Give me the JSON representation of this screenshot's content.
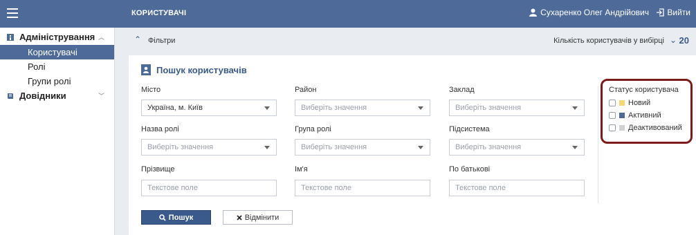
{
  "header": {
    "title": "КОРИСТУВАЧІ",
    "user_name": "Сухаренко Олег Андрійович",
    "logout_label": "Вийти"
  },
  "sidebar": {
    "sections": [
      {
        "label": "Адміністрування",
        "items": [
          {
            "label": "Користувачі",
            "active": true
          },
          {
            "label": "Ролі",
            "active": false
          },
          {
            "label": "Групи ролі",
            "active": false
          }
        ]
      },
      {
        "label": "Довідники",
        "items": []
      }
    ]
  },
  "filterbar": {
    "label": "Фільтри",
    "count_label": "Кількість користувачів у вибірці",
    "count_value": "20"
  },
  "search_panel": {
    "title": "Пошук користувачів",
    "fields": {
      "city": {
        "label": "Місто",
        "value": "Україна, м. Київ"
      },
      "district": {
        "label": "Район",
        "placeholder": "Виберіть значення"
      },
      "institution": {
        "label": "Заклад",
        "placeholder": "Виберіть значення"
      },
      "role_name": {
        "label": "Назва ролі",
        "placeholder": "Виберіть значення"
      },
      "role_group": {
        "label": "Група ролі",
        "placeholder": "Виберіть значення"
      },
      "subsystem": {
        "label": "Підсистема",
        "placeholder": "Виберіть значення"
      },
      "surname": {
        "label": "Прізвище",
        "placeholder": "Текстове поле"
      },
      "name": {
        "label": "Ім'я",
        "placeholder": "Текстове поле"
      },
      "patronymic": {
        "label": "По батькові",
        "placeholder": "Текстове поле"
      }
    },
    "search_button": "Пошук",
    "cancel_button": "Відмінити"
  },
  "user_status": {
    "title": "Статус користувача",
    "options": [
      {
        "label": "Новий",
        "color": "#f7d774",
        "checked": false
      },
      {
        "label": "Активний",
        "color": "#4e6a99",
        "checked": false
      },
      {
        "label": "Деактивований",
        "color": "#d2d2d2",
        "checked": false
      }
    ]
  }
}
